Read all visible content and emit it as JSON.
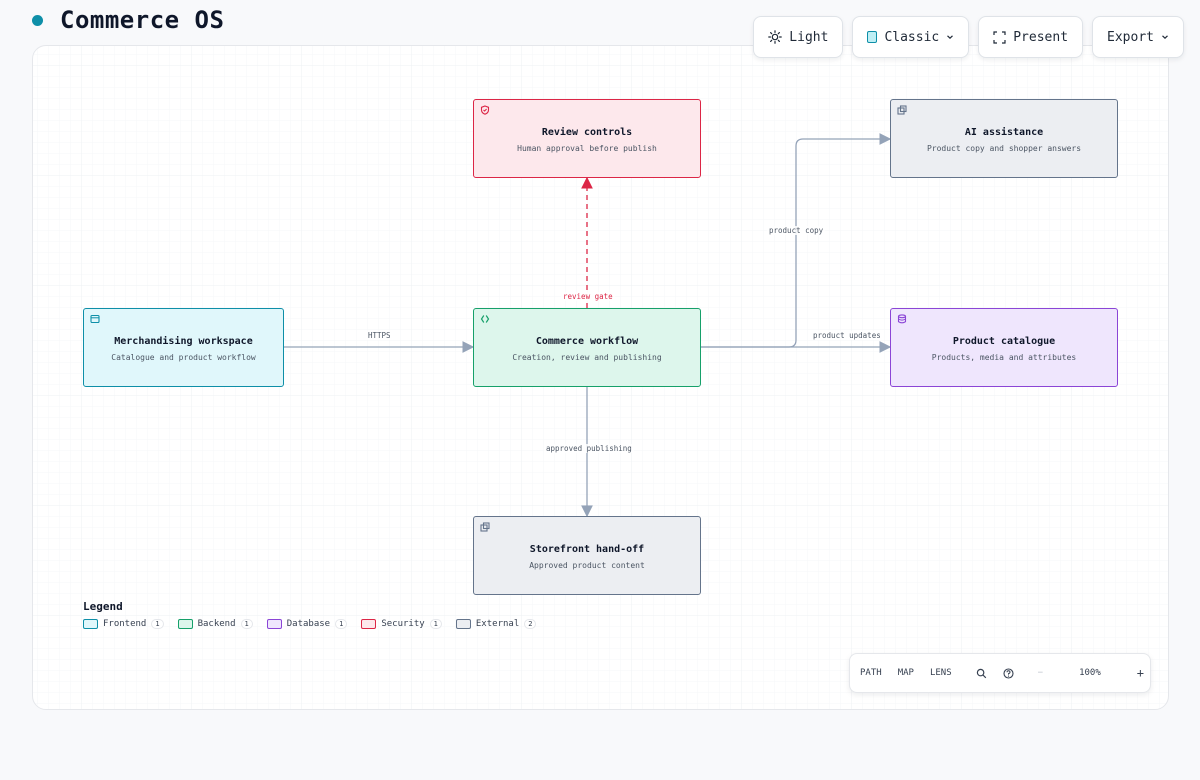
{
  "app": {
    "title": "Commerce OS"
  },
  "toolbar": {
    "theme_label": "Light",
    "style_label": "Classic",
    "present_label": "Present",
    "export_label": "Export"
  },
  "nodes": {
    "review": {
      "title": "Review controls",
      "subtitle": "Human approval before publish",
      "kind": "Security"
    },
    "ai": {
      "title": "AI assistance",
      "subtitle": "Product copy and shopper answers",
      "kind": "External"
    },
    "merch": {
      "title": "Merchandising workspace",
      "subtitle": "Catalogue and product workflow",
      "kind": "Frontend"
    },
    "workflow": {
      "title": "Commerce workflow",
      "subtitle": "Creation, review and publishing",
      "kind": "Backend"
    },
    "catalogue": {
      "title": "Product catalogue",
      "subtitle": "Products, media and attributes",
      "kind": "Database"
    },
    "storefront": {
      "title": "Storefront hand-off",
      "subtitle": "Approved product content",
      "kind": "External"
    }
  },
  "edges": {
    "https": "HTTPS",
    "review_gate": "review gate",
    "product_copy": "product copy",
    "product_updates": "product updates",
    "approved_publishing": "approved publishing"
  },
  "legend": {
    "title": "Legend",
    "items": [
      {
        "label": "Frontend",
        "count": "1"
      },
      {
        "label": "Backend",
        "count": "1"
      },
      {
        "label": "Database",
        "count": "1"
      },
      {
        "label": "Security",
        "count": "1"
      },
      {
        "label": "External",
        "count": "2"
      }
    ]
  },
  "controls": {
    "path": "PATH",
    "map": "MAP",
    "lens": "LENS",
    "zoom_out": "−",
    "zoom": "100%",
    "zoom_in": "+"
  },
  "colors": {
    "accent": "#0e8fa8",
    "frontend": "#0e8fa8",
    "backend": "#16a06a",
    "database": "#8b45d6",
    "security": "#dc2646",
    "external": "#64748b",
    "edge": "#94a3b8"
  }
}
